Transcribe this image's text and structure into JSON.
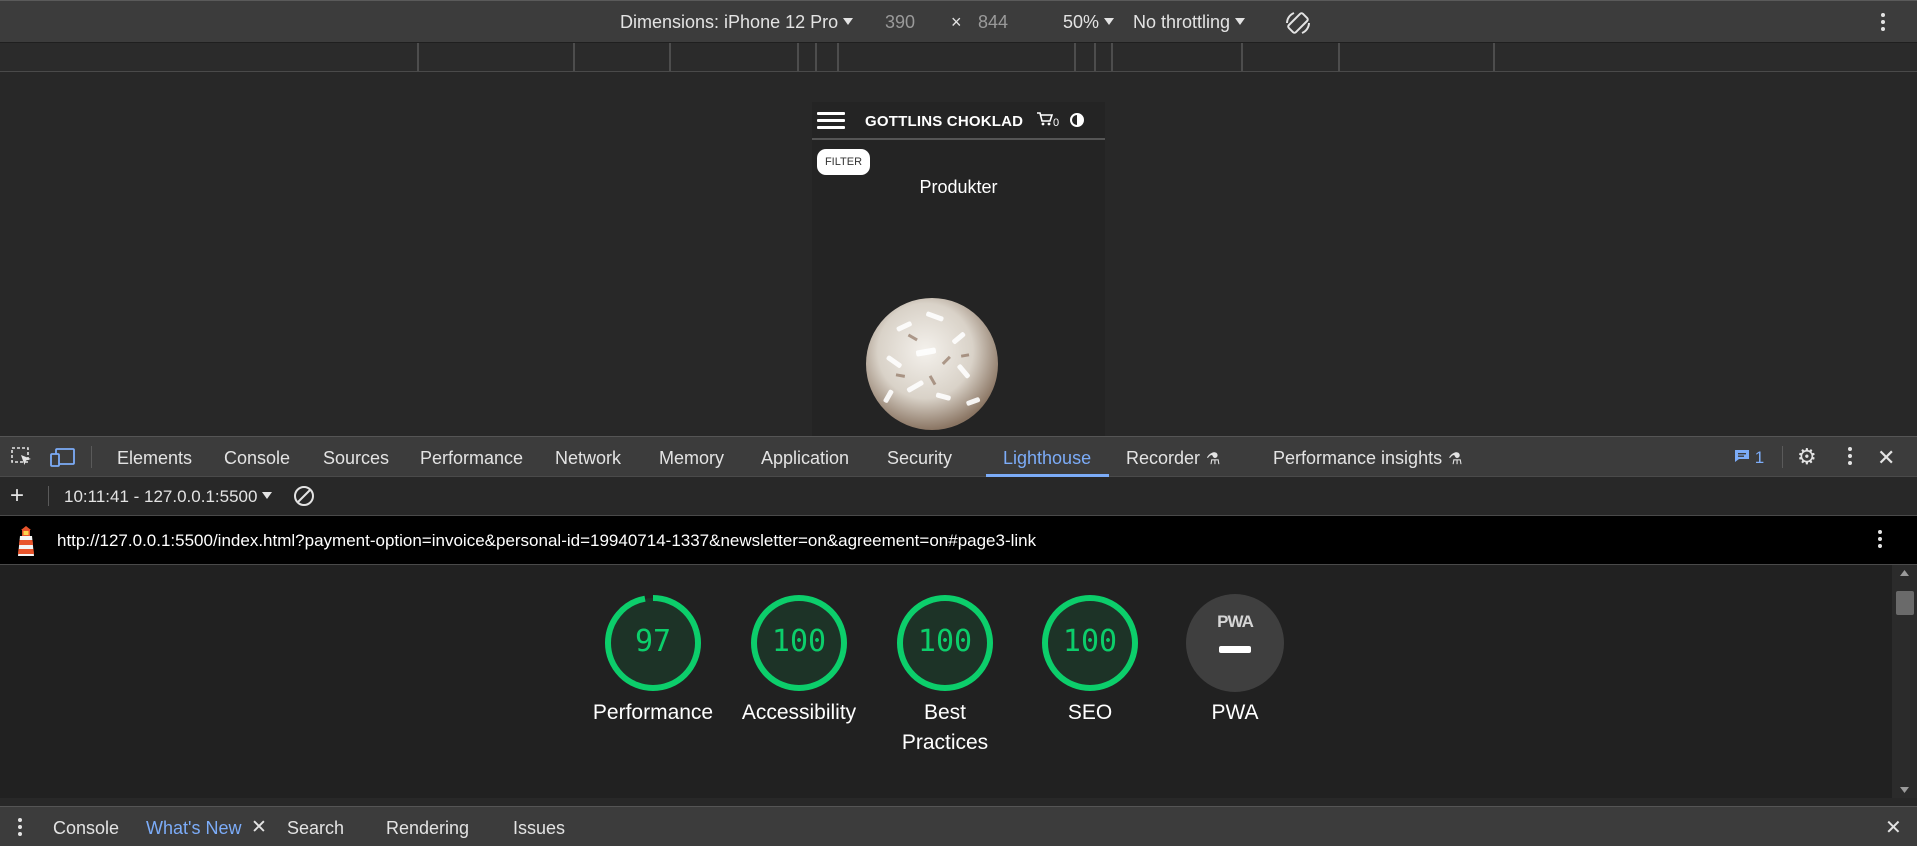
{
  "device_toolbar": {
    "dimensions_label": "Dimensions: iPhone 12 Pro",
    "width_value": "390",
    "times": "×",
    "height_value": "844",
    "zoom": "50%",
    "throttling": "No throttling"
  },
  "phone": {
    "brand": "GOTTLINS CHOKLAD",
    "cart_count": "0",
    "filter_label": "FILTER",
    "heading": "Produkter"
  },
  "devtools": {
    "tabs": [
      "Elements",
      "Console",
      "Sources",
      "Performance",
      "Network",
      "Memory",
      "Application",
      "Security",
      "Lighthouse",
      "Recorder",
      "Performance insights"
    ],
    "active_tab": "Lighthouse",
    "issues_count": "1"
  },
  "report_toolbar": {
    "report_label": "10:11:41 - 127.0.0.1:5500"
  },
  "url_bar": {
    "url": "http://127.0.0.1:5500/index.html?payment-option=invoice&personal-id=19940714-1337&newsletter=on&agreement=on#page3-link"
  },
  "scores": [
    {
      "label": "Performance",
      "score": "97",
      "value": 97
    },
    {
      "label": "Accessibility",
      "score": "100",
      "value": 100
    },
    {
      "label": "Best Practices",
      "score": "100",
      "value": 100
    },
    {
      "label": "SEO",
      "score": "100",
      "value": 100
    },
    {
      "label": "PWA",
      "score": "",
      "value": null,
      "badge": "PWA"
    }
  ],
  "colors": {
    "pass": "#0cce6b",
    "accent": "#7cacf8"
  },
  "drawer": {
    "tabs": [
      "Console",
      "What's New",
      "Search",
      "Rendering",
      "Issues"
    ],
    "active_tab": "What's New"
  }
}
